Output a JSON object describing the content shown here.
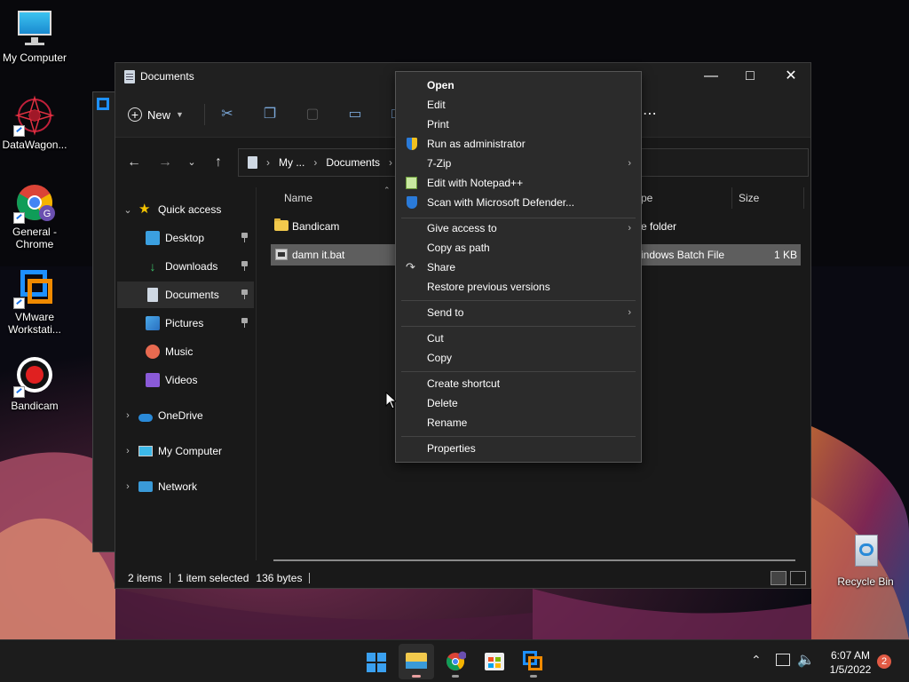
{
  "desktop": {
    "icons": [
      {
        "label": "My Computer",
        "icon": "monitor-icon"
      },
      {
        "label": "DataWagon...",
        "icon": "datawagon-icon"
      },
      {
        "label": "General - Chrome",
        "icon": "chrome-icon"
      },
      {
        "label": "VMware Workstati...",
        "icon": "vmware-icon"
      },
      {
        "label": "Bandicam",
        "icon": "bandicam-icon"
      },
      {
        "label": "Recycle Bin",
        "icon": "recycle-bin-icon"
      }
    ]
  },
  "explorer": {
    "title": "Documents",
    "toolbar": {
      "new_label": "New"
    },
    "breadcrumb": [
      "My ...",
      "Documents"
    ],
    "nav_items": [
      {
        "label": "Quick access",
        "icon": "star-icon"
      },
      {
        "label": "Desktop",
        "icon": "desktop-icon"
      },
      {
        "label": "Downloads",
        "icon": "download-icon"
      },
      {
        "label": "Documents",
        "icon": "documents-icon"
      },
      {
        "label": "Pictures",
        "icon": "pictures-icon"
      },
      {
        "label": "Music",
        "icon": "music-icon"
      },
      {
        "label": "Videos",
        "icon": "videos-icon"
      },
      {
        "label": "OneDrive",
        "icon": "cloud-icon"
      },
      {
        "label": "My Computer",
        "icon": "monitor-icon"
      },
      {
        "label": "Network",
        "icon": "network-icon"
      }
    ],
    "columns": {
      "name": "Name",
      "type": "pe",
      "size": "Size"
    },
    "files": [
      {
        "name": "Bandicam",
        "type": "e folder",
        "size": ""
      },
      {
        "name": "damn it.bat",
        "type": "indows Batch File",
        "size": "1 KB"
      }
    ],
    "status": {
      "items": "2 items",
      "selected": "1 item selected",
      "bytes": "136 bytes"
    }
  },
  "context_menu": {
    "items": [
      {
        "label": "Open"
      },
      {
        "label": "Edit"
      },
      {
        "label": "Print"
      },
      {
        "label": "Run as administrator"
      },
      {
        "label": "7-Zip"
      },
      {
        "label": "Edit with Notepad++"
      },
      {
        "label": "Scan with Microsoft Defender..."
      },
      {
        "label": "Give access to"
      },
      {
        "label": "Copy as path"
      },
      {
        "label": "Share"
      },
      {
        "label": "Restore previous versions"
      },
      {
        "label": "Send to"
      },
      {
        "label": "Cut"
      },
      {
        "label": "Copy"
      },
      {
        "label": "Create shortcut"
      },
      {
        "label": "Delete"
      },
      {
        "label": "Rename"
      },
      {
        "label": "Properties"
      }
    ]
  },
  "taskbar": {
    "time": "6:07 AM",
    "date": "1/5/2022",
    "notification_count": "2",
    "apps": [
      "start-icon",
      "file-explorer-icon",
      "chrome-icon",
      "store-icon",
      "vmware-icon"
    ]
  },
  "colors": {
    "accent": "#0078d4",
    "selection": "#5e5e5e",
    "menu_bg": "#2b2b2b"
  }
}
